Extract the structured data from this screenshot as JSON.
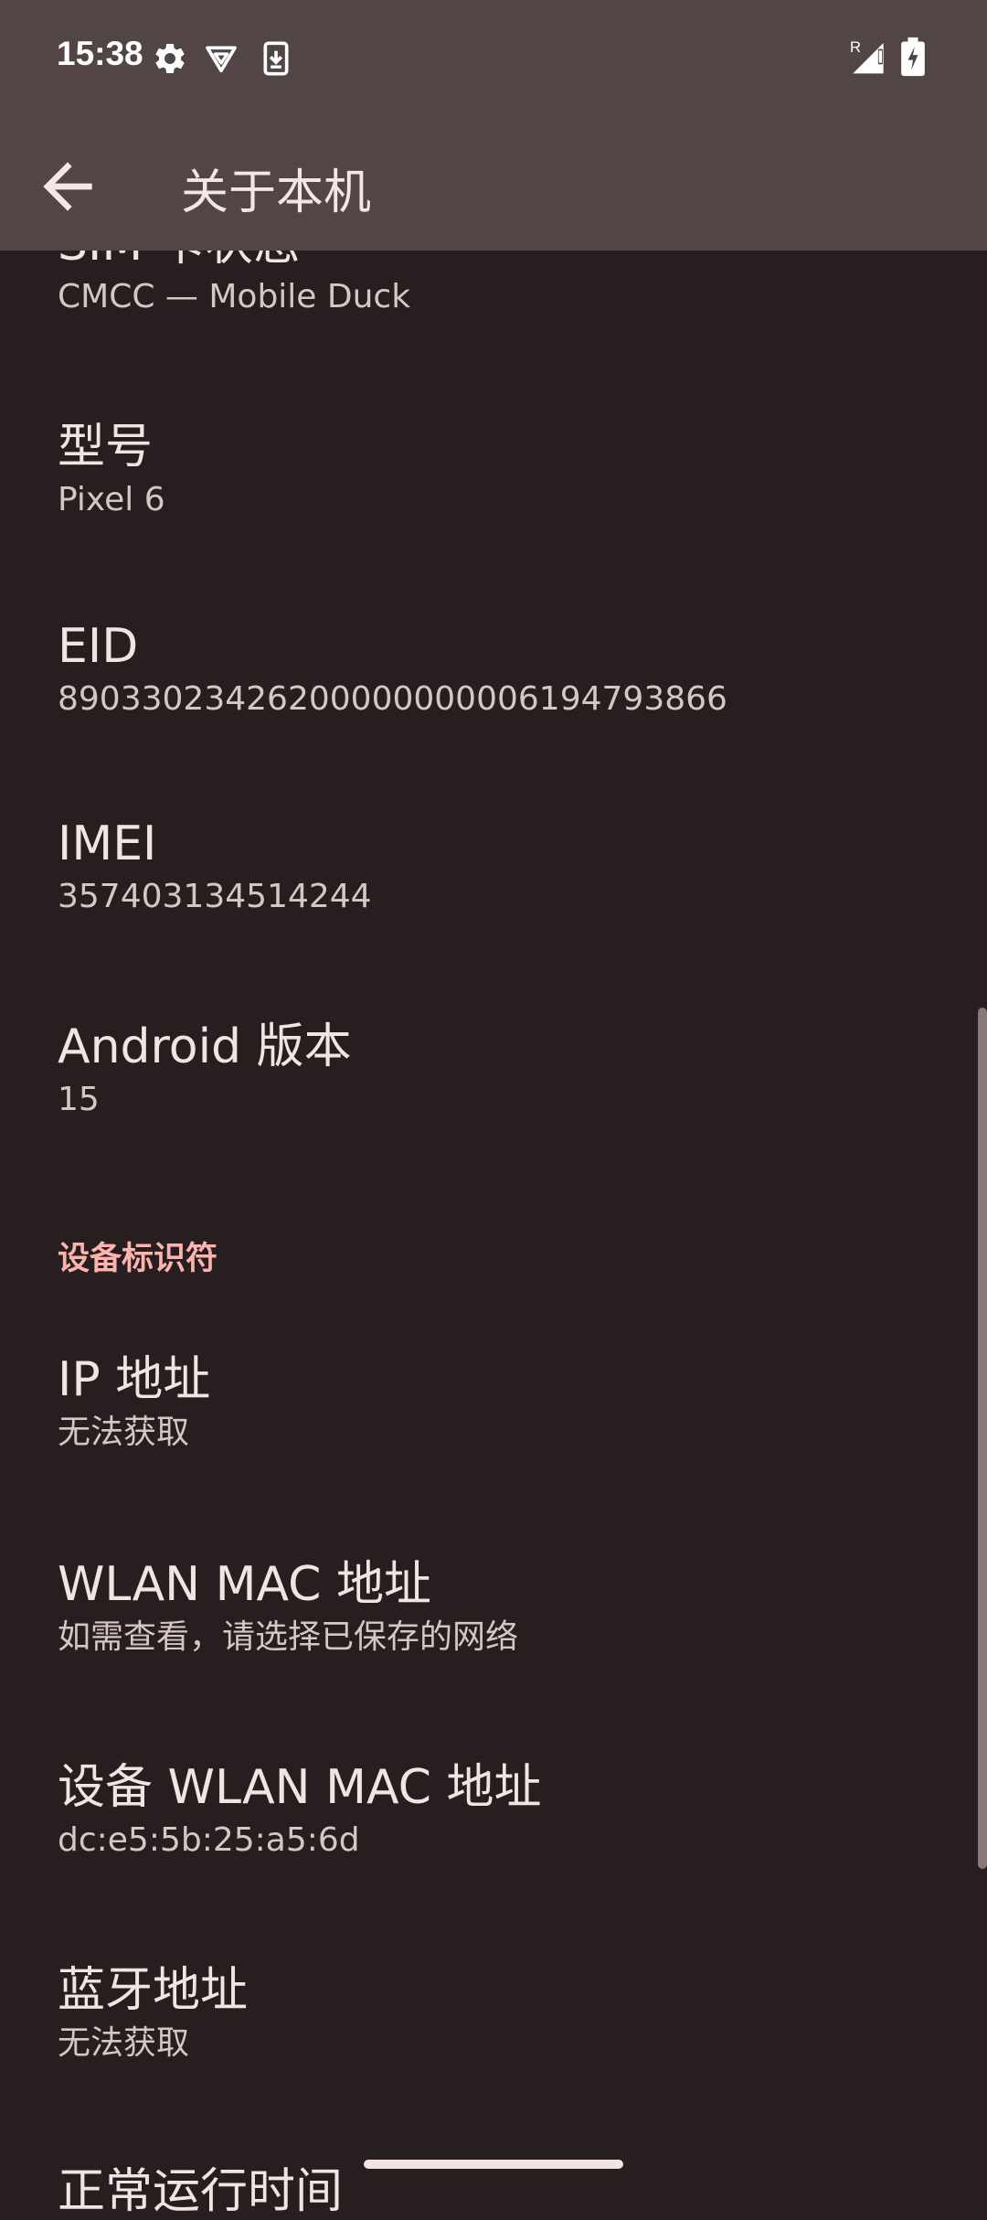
{
  "status_bar": {
    "time": "15:38",
    "icons_left": [
      "gear-icon",
      "vpn-shield-icon",
      "download-icon"
    ],
    "icons_right": [
      "signal-roaming-icon",
      "battery-charging-icon"
    ],
    "roaming_letter": "R"
  },
  "toolbar": {
    "title": "关于本机"
  },
  "items": [
    {
      "title": "SIM 卡状态",
      "summary": "CMCC — Mobile Duck"
    },
    {
      "title": "型号",
      "summary": "Pixel 6"
    },
    {
      "title": "EID",
      "summary": "89033023426200000000006194793866"
    },
    {
      "title": "IMEI",
      "summary": "357403134514244"
    },
    {
      "title": "Android 版本",
      "summary": "15"
    },
    {
      "title": "IP 地址",
      "summary": "无法获取"
    },
    {
      "title": "WLAN MAC 地址",
      "summary": "如需查看，请选择已保存的网络"
    },
    {
      "title": "设备 WLAN MAC 地址",
      "summary": "dc:e5:5b:25:a5:6d"
    },
    {
      "title": "蓝牙地址",
      "summary": "无法获取"
    },
    {
      "title": "正常运行时间",
      "summary": ""
    }
  ],
  "section_header": "设备标识符",
  "colors": {
    "background": "#261e1f",
    "appbar": "#524546",
    "accent": "#ffb3ad"
  }
}
